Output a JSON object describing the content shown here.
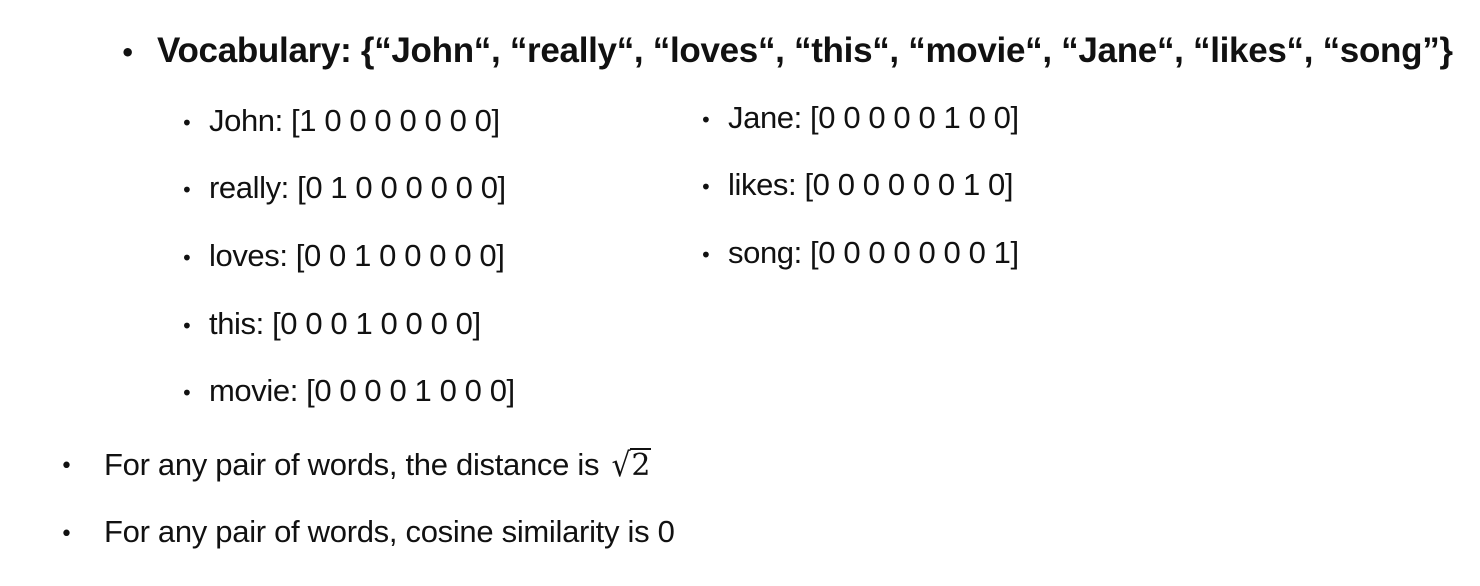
{
  "heading": {
    "bullet": "•",
    "text": "Vocabulary: {“John“, “really“, “loves“, “this“, “movie“, “Jane“, “likes“, “song”}"
  },
  "left_items": [
    {
      "bullet": "•",
      "text": "John: [1 0 0 0 0 0 0 0]"
    },
    {
      "bullet": "•",
      "text": "really: [0 1 0 0 0 0 0 0]"
    },
    {
      "bullet": "•",
      "text": "loves: [0 0 1 0 0 0 0 0]"
    },
    {
      "bullet": "•",
      "text": "this: [0 0 0 1 0 0 0 0]"
    },
    {
      "bullet": "•",
      "text": "movie: [0 0 0 0 1 0 0 0]"
    }
  ],
  "right_items": [
    {
      "bullet": "•",
      "text": "Jane: [0 0 0 0 0 1 0 0]"
    },
    {
      "bullet": "•",
      "text": "likes: [0 0 0 0 0 0 1 0]"
    },
    {
      "bullet": "•",
      "text": "song: [0 0 0 0 0 0 0 1]"
    }
  ],
  "notes": [
    {
      "bullet": "•",
      "text": "For any pair of words, the distance is",
      "math_radical": "√",
      "math_radicand": "2"
    },
    {
      "bullet": "•",
      "text": "For any pair of words, cosine similarity is 0"
    }
  ]
}
